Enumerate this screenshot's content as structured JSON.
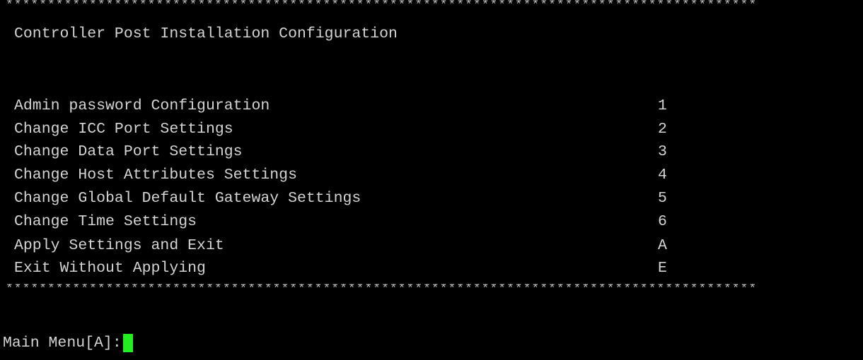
{
  "border": "******************************************************************************************",
  "title": "Controller Post Installation Configuration",
  "menu": [
    {
      "label": "Admin password Configuration",
      "key": "1"
    },
    {
      "label": "Change ICC Port Settings",
      "key": "2"
    },
    {
      "label": "Change Data Port Settings",
      "key": "3"
    },
    {
      "label": "Change Host Attributes Settings",
      "key": "4"
    },
    {
      "label": "Change Global Default Gateway Settings",
      "key": "5"
    },
    {
      "label": "Change Time Settings",
      "key": "6"
    },
    {
      "label": "Apply Settings and Exit",
      "key": "A"
    },
    {
      "label": "Exit Without Applying",
      "key": "E"
    }
  ],
  "prompt": "Main Menu[A]:",
  "colors": {
    "background": "#000000",
    "text": "#d4d4d4",
    "cursor": "#22ee22"
  }
}
